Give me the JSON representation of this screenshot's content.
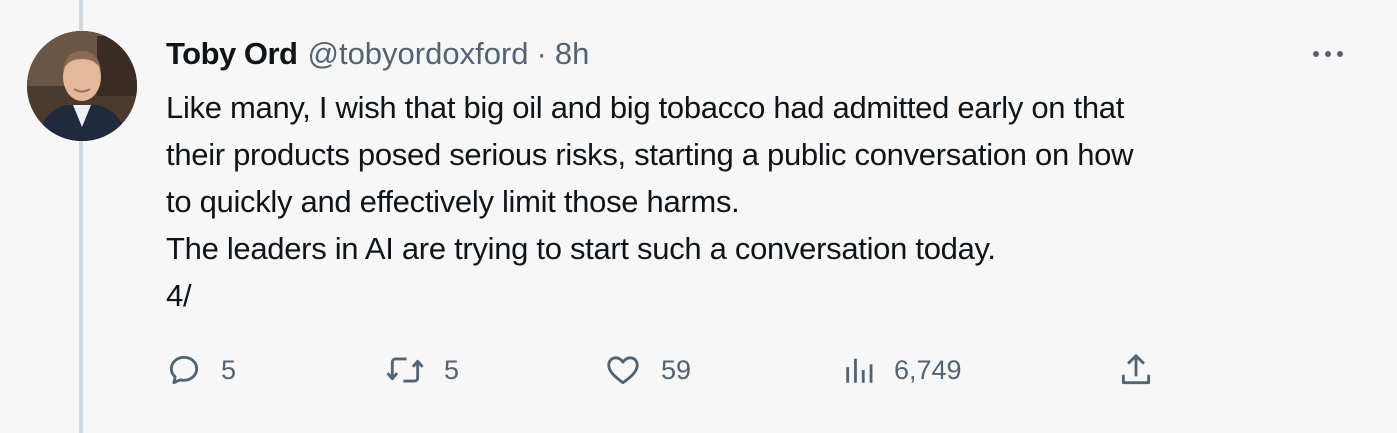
{
  "tweet": {
    "author_name": "Toby Ord",
    "handle": "@tobyordoxford",
    "separator": "·",
    "time": "8h",
    "text_lines": [
      "Like many, I wish that big oil and big tobacco had admitted early on that",
      "their products posed serious risks, starting a public conversation on how",
      "to quickly and effectively limit those harms.",
      "The leaders in AI are trying to start such a conversation today.",
      "4/"
    ],
    "actions": {
      "replies": "5",
      "retweets": "5",
      "likes": "59",
      "views": "6,749"
    }
  },
  "icons": {
    "more": "more-horizontal-icon",
    "reply": "reply-icon",
    "retweet": "retweet-icon",
    "like": "heart-icon",
    "views": "analytics-icon",
    "share": "share-icon"
  },
  "colors": {
    "background": "#f7f7f7",
    "text": "#0f1419",
    "secondary": "#536471",
    "thread_line": "#cfd9de"
  }
}
